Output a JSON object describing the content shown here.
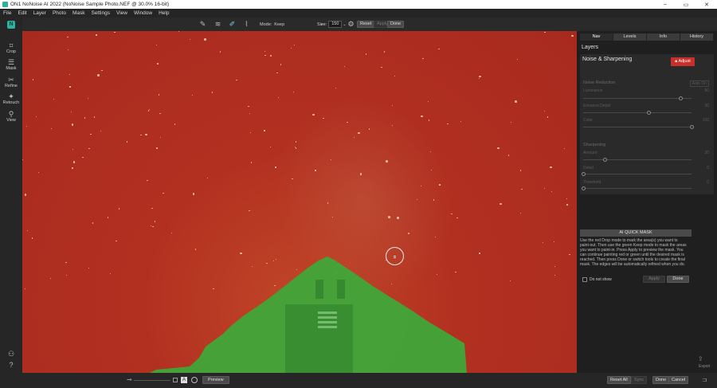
{
  "titlebar": {
    "title": "ON1 NoNoise AI 2022 (NoNoise Sample Photo.NEF @ 30.0% 16-bit)",
    "minimize": "–",
    "maximize": "▭",
    "close": "✕"
  },
  "menu": [
    "File",
    "Edit",
    "Layer",
    "Photo",
    "Mask",
    "Settings",
    "View",
    "Window",
    "Help"
  ],
  "toolbar": {
    "mode_label": "Mode:",
    "mode_value": "Keep",
    "size_label": "Size:",
    "size_value": "150",
    "reset_label": "Reset",
    "apply_label": "Apply",
    "done_label": "Done"
  },
  "left_tools": [
    {
      "label": "Crop",
      "icon": "crop-icon"
    },
    {
      "label": "Mask",
      "icon": "mask-icon"
    },
    {
      "label": "Refine",
      "icon": "refine-icon"
    },
    {
      "label": "Retouch",
      "icon": "retouch-icon"
    },
    {
      "label": "View",
      "icon": "view-icon"
    }
  ],
  "panel": {
    "tabs": [
      "Nav",
      "Levels",
      "Info",
      "History"
    ],
    "active_tab": "Nav",
    "layers_label": "Layers",
    "section_title": "Noise & Sharpening",
    "adjust_label": "Adjust",
    "noise_reduction": {
      "title": "Noise Reduction",
      "auto_label": "Auto On",
      "sliders": [
        {
          "label": "Luminance",
          "value": "80",
          "fraction": 0.9
        },
        {
          "label": "Enhance Detail",
          "value": "30",
          "fraction": 0.6
        },
        {
          "label": "Color",
          "value": "100",
          "fraction": 1.0
        }
      ]
    },
    "sharpening": {
      "title": "Sharpening",
      "sliders": [
        {
          "label": "Amount",
          "value": "20",
          "fraction": 0.2
        },
        {
          "label": "Detail",
          "value": "0",
          "fraction": 0.0
        },
        {
          "label": "Threshold",
          "value": "0",
          "fraction": 0.0
        }
      ]
    },
    "quick_mask": {
      "header": "AI QUICK MASK",
      "description": "Use the red Drop mode to mark the area(s) you want to paint-out. Then use the green Keep mode to mask the areas you want to paint-in. Press Apply to preview the mask. You can continue painting red or green until the desired mask is reached. Then press Done or switch tools to create the final mask. The edges will be automatically refined when you do.",
      "do_not_show": "Do not show",
      "apply_label": "Apply",
      "done_label": "Done"
    }
  },
  "bottom": {
    "preview_label": "Preview",
    "reset_all_label": "Reset All",
    "sync_label": "Sync",
    "done_label": "Done",
    "cancel_label": "Cancel",
    "export_label": "Export"
  },
  "colors": {
    "drop_red": "#b23020",
    "keep_green": "#3fa63a",
    "accent": "#2bb3a0",
    "adjust_red": "#c9302c"
  }
}
